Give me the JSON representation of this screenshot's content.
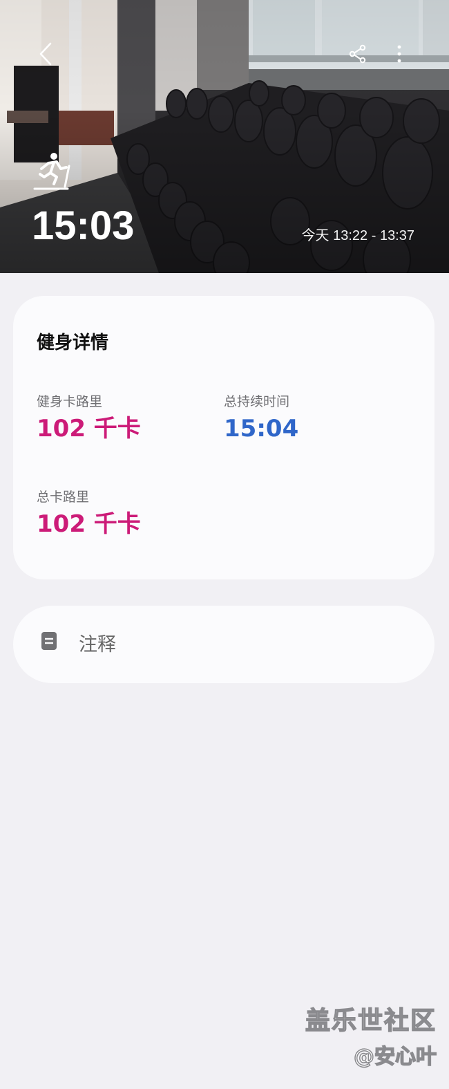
{
  "header": {
    "duration": "15:03",
    "time_range": "今天 13:22 - 13:37",
    "back_icon": "chevron-left-icon",
    "share_icon": "share-icon",
    "more_icon": "more-vertical-icon",
    "activity_icon": "treadmill-runner-icon"
  },
  "details": {
    "title": "健身详情",
    "stats": [
      {
        "label": "健身卡路里",
        "value": "102 千卡",
        "color": "#cc1b78"
      },
      {
        "label": "总持续时间",
        "value": "15:04",
        "color": "#2f66c9"
      },
      {
        "label": "总卡路里",
        "value": "102 千卡",
        "color": "#cc1b78"
      }
    ]
  },
  "notes": {
    "icon": "note-icon",
    "label": "注释"
  },
  "watermark": {
    "line1": "盖乐世社区",
    "line2": "@安心叶"
  }
}
